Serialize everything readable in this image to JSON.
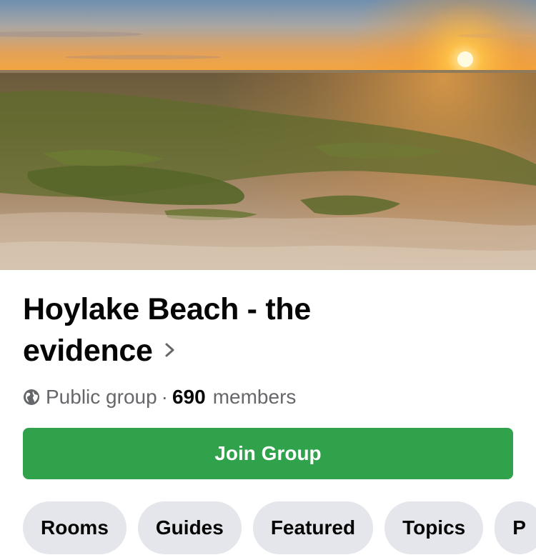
{
  "group": {
    "name": "Hoylake Beach - the evidence",
    "privacy": "Public group",
    "separator": "·",
    "member_count": "690",
    "member_label": "members"
  },
  "actions": {
    "join_label": "Join Group"
  },
  "tabs": [
    {
      "label": "Rooms"
    },
    {
      "label": "Guides"
    },
    {
      "label": "Featured"
    },
    {
      "label": "Topics"
    },
    {
      "label": "P"
    }
  ],
  "colors": {
    "join_button": "#31a24c",
    "chip_background": "#e4e6eb",
    "secondary_text": "#65676b"
  },
  "icons": {
    "privacy": "globe-icon",
    "title_chevron": "chevron-right-icon"
  }
}
